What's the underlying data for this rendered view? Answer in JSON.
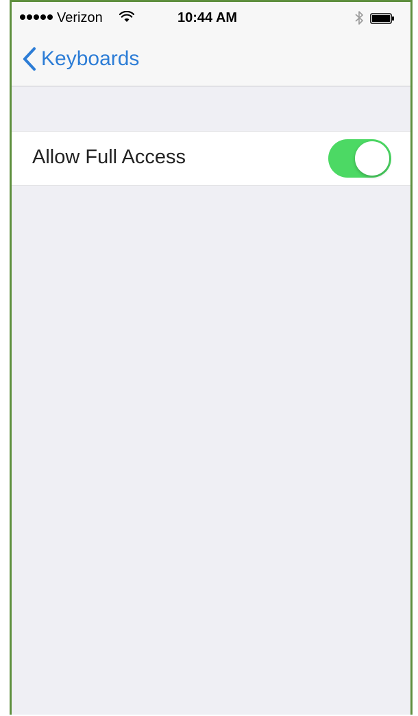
{
  "status_bar": {
    "carrier": "Verizon",
    "time": "10:44 AM",
    "signal_bars": 5,
    "icons": [
      "wifi-icon",
      "bluetooth-icon",
      "battery-icon"
    ]
  },
  "nav": {
    "back_label": "Keyboards",
    "back_icon": "chevron-left-icon"
  },
  "settings": {
    "rows": [
      {
        "label": "Allow Full Access",
        "toggle_on": true
      }
    ]
  },
  "colors": {
    "accent": "#2d7dd6",
    "toggle_on": "#4cd964",
    "background": "#efeff4",
    "frame_border": "#5e8f3e"
  }
}
